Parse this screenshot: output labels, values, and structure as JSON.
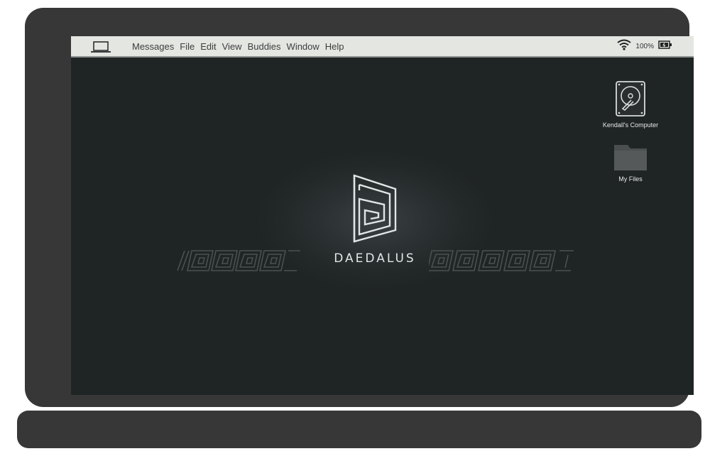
{
  "menubar": {
    "items": [
      "Messages",
      "File",
      "Edit",
      "View",
      "Buddies",
      "Window",
      "Help"
    ],
    "battery": "100%",
    "icons": [
      "laptop-icon",
      "wifi-icon",
      "battery-icon"
    ]
  },
  "splash": {
    "brand": "DAEDALUS"
  },
  "desktop": {
    "icons": [
      {
        "label": "Kendall's Computer",
        "icon": "hard-drive-icon"
      },
      {
        "label": "My Files",
        "icon": "folder-icon"
      }
    ]
  },
  "colors": {
    "bezel": "#373737",
    "screen": "#1f2424",
    "menubar": "#e4e6e2",
    "text_light": "#e8e8e8"
  }
}
